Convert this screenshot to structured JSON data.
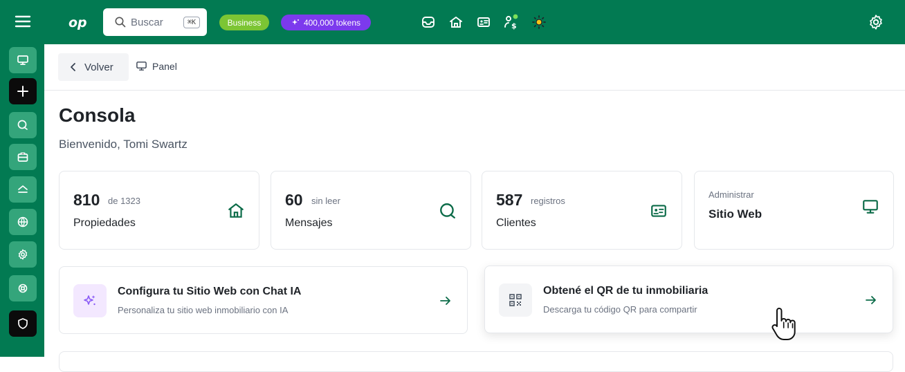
{
  "topbar": {
    "search_placeholder": "Buscar",
    "search_shortcut": "⌘K",
    "plan_badge": "Business",
    "tokens_badge": "400,000 tokens"
  },
  "header": {
    "back_label": "Volver",
    "breadcrumb": "Panel"
  },
  "page": {
    "title": "Consola",
    "welcome": "Bienvenido, Tomi Swartz"
  },
  "stats": [
    {
      "value": "810",
      "suffix": "de 1323",
      "label": "Propiedades",
      "icon": "home-icon"
    },
    {
      "value": "60",
      "suffix": "sin leer",
      "label": "Mensajes",
      "icon": "chat-icon"
    },
    {
      "value": "587",
      "suffix": "registros",
      "label": "Clientes",
      "icon": "id-card-icon"
    }
  ],
  "website_card": {
    "caption": "Administrar",
    "label": "Sitio Web",
    "icon": "monitor-icon"
  },
  "actions": [
    {
      "title": "Configura tu Sitio Web con Chat IA",
      "description": "Personaliza tu sitio web inmobiliario con IA",
      "icon": "sparkles-icon"
    },
    {
      "title": "Obtené el QR de tu inmobiliaria",
      "description": "Descarga tu código QR para compartir",
      "icon": "qr-code-icon"
    }
  ],
  "colors": {
    "brand": "#027a52",
    "sidebar_button": "#34a57b",
    "business_badge": "#7cc534",
    "tokens_badge": "#7c3aed",
    "icon_green": "#0b6b48"
  }
}
